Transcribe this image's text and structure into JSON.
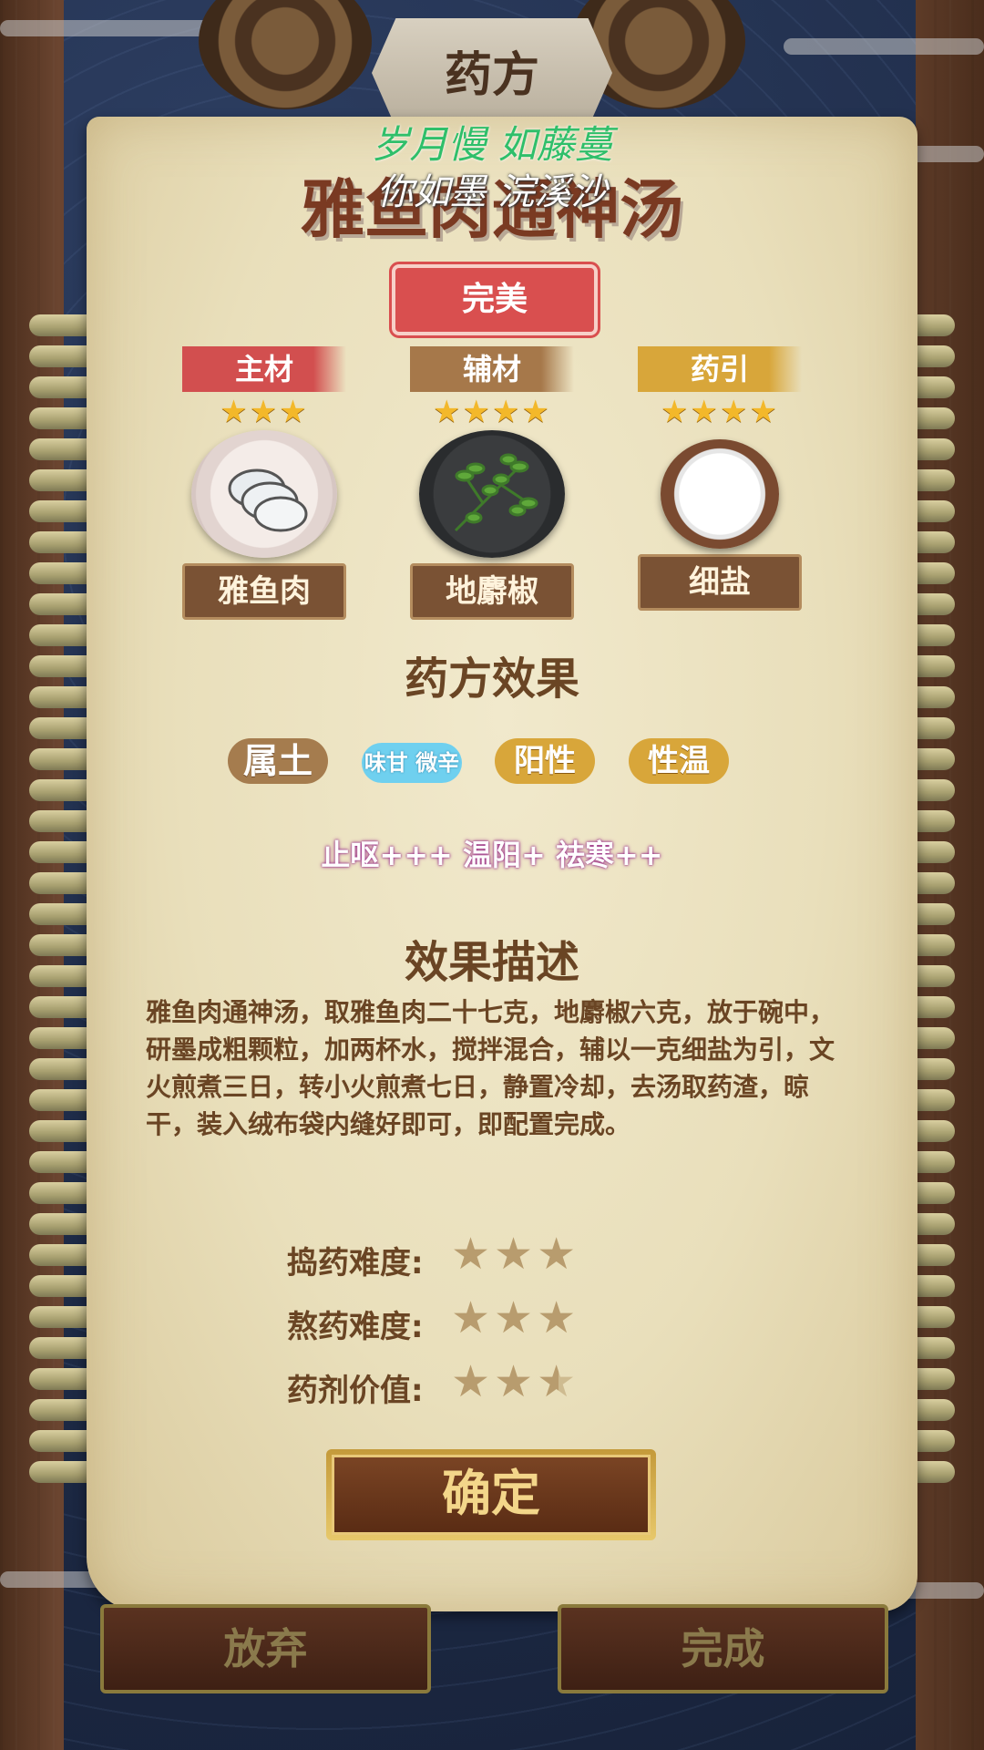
{
  "header": {
    "title": "药方"
  },
  "overlay_lines": [
    "岁月慢 如藤蔓",
    "你如墨 浣溪沙"
  ],
  "recipe": {
    "name": "雅鱼肉通神汤",
    "grade": "完美"
  },
  "ingredients": [
    {
      "role": "主材",
      "stars": "★★★",
      "star_count": 3,
      "name": "雅鱼肉",
      "tag_color": "#d24f4f"
    },
    {
      "role": "辅材",
      "stars": "★★★★",
      "star_count": 4,
      "name": "地麝椒",
      "tag_color": "#a6784a"
    },
    {
      "role": "药引",
      "stars": "★★★★",
      "star_count": 4,
      "name": "细盐",
      "tag_color": "#d8a63a"
    }
  ],
  "effects_section": {
    "title": "药方效果",
    "attributes": [
      {
        "label": "属土",
        "color": "#a57c4e"
      },
      {
        "label": "味甘 微辛",
        "color": "#6fd0ef"
      },
      {
        "label": "阳性",
        "color": "#d8a63a"
      },
      {
        "label": "性温",
        "color": "#d8a63a"
      }
    ],
    "effects_line": "止呕+++ 温阳+ 祛寒++"
  },
  "description_section": {
    "title": "效果描述",
    "text": "雅鱼肉通神汤，取雅鱼肉二十七克，地麝椒六克，放于碗中，研墨成粗颗粒，加两杯水，搅拌混合，辅以一克细盐为引，文火煎煮三日，转小火煎煮七日，静置冷却，去汤取药渣，晾干，装入绒布袋内缝好即可，即配置完成。"
  },
  "ratings": [
    {
      "label": "捣药难度:",
      "value": 3,
      "stars": "★★★"
    },
    {
      "label": "熬药难度:",
      "value": 3,
      "stars": "★★★"
    },
    {
      "label": "药剂价值:",
      "value": 2.5,
      "stars": "★★★"
    }
  ],
  "buttons": {
    "confirm": "确定",
    "abandon": "放弃",
    "complete": "完成"
  }
}
